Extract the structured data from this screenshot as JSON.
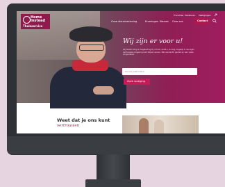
{
  "brand": {
    "name_line1": "Home",
    "name_line2": "Instead",
    "sub": "Thuisservice"
  },
  "utility_links": [
    "Franchise",
    "Vacatures",
    "Vestigingen"
  ],
  "nav": {
    "items": [
      "Onze dienstverlening",
      "Ervaringen",
      "Nieuws",
      "Over ons"
    ],
    "contact_label": "Contact"
  },
  "hero": {
    "headline": "Wij zijn er voor u!",
    "intro": "Wij bieden zorg en begeleiding bij u thuis, zodat u zo lang mogelijk in uw eigen vertrouwde omgeving kunt blijven wonen. Met aandacht, geduld en een vaste zorgverlener.",
    "zip_placeholder": "Vul uw postcode in",
    "search_label": "Zoek vestiging"
  },
  "section": {
    "title": "Weet dat je ons kunt",
    "subtitle": "vertrouwen"
  },
  "colors": {
    "brand": "#8f1b4c",
    "accent": "#c21c59"
  }
}
